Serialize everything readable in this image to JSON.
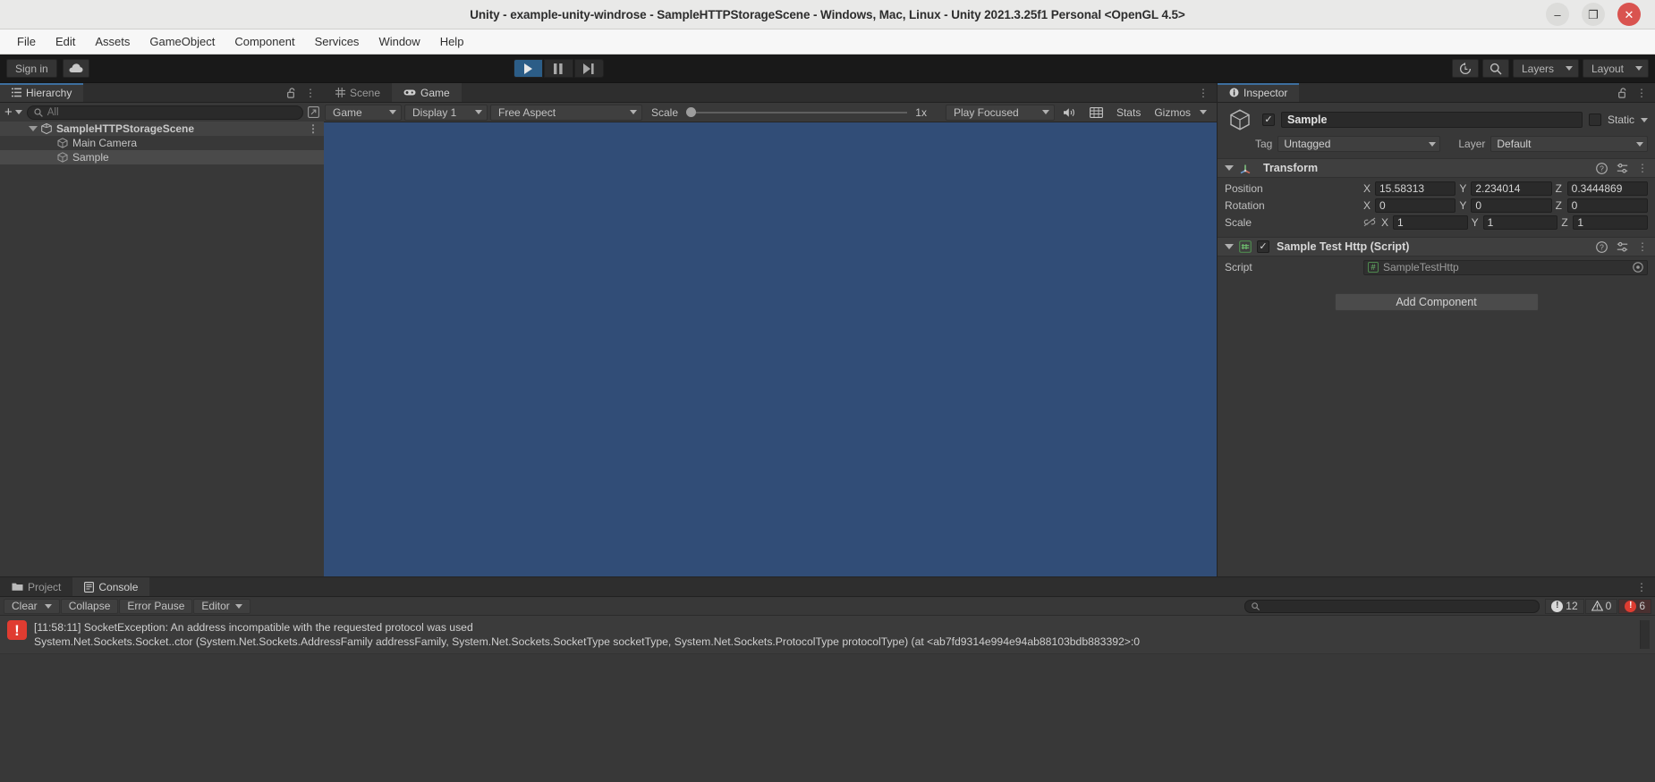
{
  "window": {
    "title": "Unity - example-unity-windrose - SampleHTTPStorageScene - Windows, Mac, Linux - Unity 2021.3.25f1 Personal <OpenGL 4.5>",
    "minimize": "–",
    "maximize": "❐",
    "close": "✕"
  },
  "menubar": {
    "items": [
      {
        "label": "File"
      },
      {
        "label": "Edit"
      },
      {
        "label": "Assets"
      },
      {
        "label": "GameObject"
      },
      {
        "label": "Component"
      },
      {
        "label": "Services"
      },
      {
        "label": "Window"
      },
      {
        "label": "Help"
      }
    ]
  },
  "toolbar": {
    "signin_label": "Sign in",
    "cloud_icon": "cloud-icon",
    "play_icon": "play-icon",
    "pause_icon": "pause-icon",
    "step_icon": "step-icon",
    "history_icon": "undo-history-icon",
    "search_icon": "search-icon",
    "layers_label": "Layers",
    "layout_label": "Layout"
  },
  "hierarchy": {
    "tab_label": "Hierarchy",
    "tab_icon": "hierarchy-icon",
    "lock_icon": "lock-open-icon",
    "menu_icon": "kebab-menu-icon",
    "create_label": "+",
    "search_placeholder": "All",
    "search_icon": "search-icon",
    "scope_icon": "scope-icon",
    "rows": [
      {
        "label": "SampleHTTPStorageScene",
        "type": "scene",
        "expanded": true
      },
      {
        "label": "Main Camera",
        "type": "gameobject",
        "selected": false
      },
      {
        "label": "Sample",
        "type": "gameobject",
        "selected": true
      }
    ]
  },
  "gameview": {
    "tabs": [
      {
        "label": "Scene",
        "icon": "scene-grid-icon",
        "active": false
      },
      {
        "label": "Game",
        "icon": "gamepad-icon",
        "active": true
      }
    ],
    "menu_icon": "kebab-menu-icon",
    "target_label": "Game",
    "display_label": "Display 1",
    "aspect_label": "Free Aspect",
    "scale_label": "Scale",
    "scale_value": "1x",
    "play_mode_label": "Play Focused",
    "mute_icon": "audio-icon",
    "stats_icon": "stats-grid-icon",
    "stats_label": "Stats",
    "gizmos_label": "Gizmos",
    "background_color": "#314d77"
  },
  "inspector": {
    "tab_label": "Inspector",
    "tab_icon": "info-icon",
    "lock_icon": "lock-open-icon",
    "menu_icon": "kebab-menu-icon",
    "object_icon": "cube-icon",
    "enabled": "✓",
    "object_name": "Sample",
    "static_label": "Static",
    "tag_label": "Tag",
    "tag_value": "Untagged",
    "layer_label": "Layer",
    "layer_value": "Default",
    "transform": {
      "title": "Transform",
      "icon": "transform-axis-icon",
      "help_icon": "help-icon",
      "preset_icon": "preset-icon",
      "menu_icon": "kebab-menu-icon",
      "rows": [
        {
          "label": "Position",
          "x": "15.58313",
          "y": "2.234014",
          "z": "0.3444869"
        },
        {
          "label": "Rotation",
          "x": "0",
          "y": "0",
          "z": "0"
        },
        {
          "label": "Scale",
          "x": "1",
          "y": "1",
          "z": "1",
          "link_icon": "link-broken-icon"
        }
      ],
      "axis_x": "X",
      "axis_y": "Y",
      "axis_z": "Z"
    },
    "script_component": {
      "title": "Sample Test Http (Script)",
      "icon": "csharp-script-icon",
      "enabled": "✓",
      "help_icon": "help-icon",
      "preset_icon": "preset-icon",
      "menu_icon": "kebab-menu-icon",
      "script_label": "Script",
      "script_value": "SampleTestHttp",
      "picker_icon": "object-picker-icon"
    },
    "add_component_label": "Add Component"
  },
  "console": {
    "tabs": [
      {
        "label": "Project",
        "icon": "folder-icon",
        "active": false
      },
      {
        "label": "Console",
        "icon": "console-icon",
        "active": true
      }
    ],
    "menu_icon": "kebab-menu-icon",
    "clear_label": "Clear",
    "collapse_label": "Collapse",
    "error_pause_label": "Error Pause",
    "editor_label": "Editor",
    "search_icon": "search-icon",
    "counters": {
      "info_count": "12",
      "warning_count": "0",
      "error_count": "6",
      "info_icon": "info-badge-icon",
      "warning_icon": "warning-triangle-icon",
      "error_icon": "error-badge-icon"
    },
    "entries": [
      {
        "severity": "error",
        "icon": "error-icon",
        "line1": "[11:58:11] SocketException: An address incompatible with the requested protocol was used",
        "line2": "System.Net.Sockets.Socket..ctor (System.Net.Sockets.AddressFamily addressFamily, System.Net.Sockets.SocketType socketType, System.Net.Sockets.ProtocolType protocolType) (at <ab7fd9314e994e94ab88103bdb883392>:0"
      }
    ]
  }
}
